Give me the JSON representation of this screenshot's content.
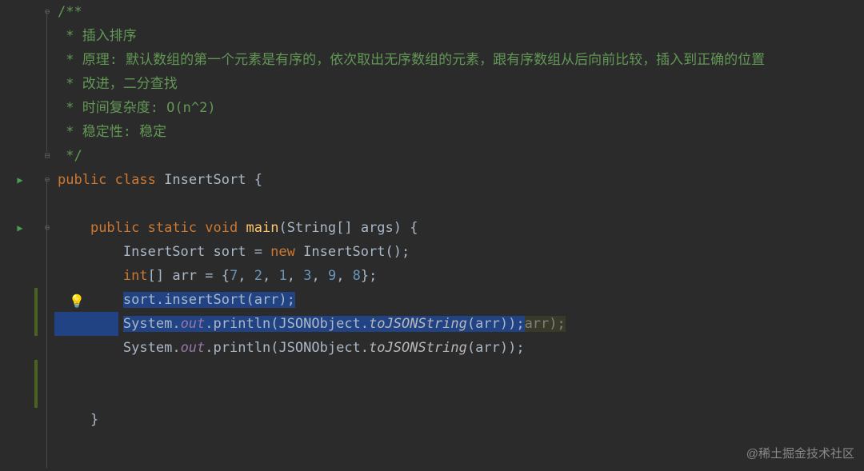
{
  "code": {
    "comment_open": "/**",
    "c1": " * 插入排序",
    "c2": " * 原理: 默认数组的第一个元素是有序的，依次取出无序数组的元素，跟有序数组从后向前比较，插入到正确的位置",
    "c3": " * 改进，二分查找",
    "c4": " * 时间复杂度: O(n^2)",
    "c5": " * 稳定性: 稳定",
    "comment_close": " */",
    "kw_public": "public",
    "kw_class": "class",
    "kw_static": "static",
    "kw_void": "void",
    "kw_new": "new",
    "kw_int_arr": "int",
    "classname": "InsertSort",
    "main_name": "main",
    "main_params_type": "String[] ",
    "main_params_name": "args",
    "sort_var": "sort",
    "arr_var": "arr",
    "arr_init_open": "[] ",
    "arr_vals": "{7, 2, 1, 3, 9, 8}",
    "n7": "7",
    "n2": "2",
    "n1": "1",
    "n3": "3",
    "n9": "9",
    "n8": "8",
    "insertsort_call": "insertSort",
    "system": "System",
    "out": "out",
    "println": "println",
    "jsonobj": "JSONObject",
    "tojson": "toJSONString",
    "extra_tail": "arr);"
  },
  "watermark": "@稀土掘金技术社区"
}
